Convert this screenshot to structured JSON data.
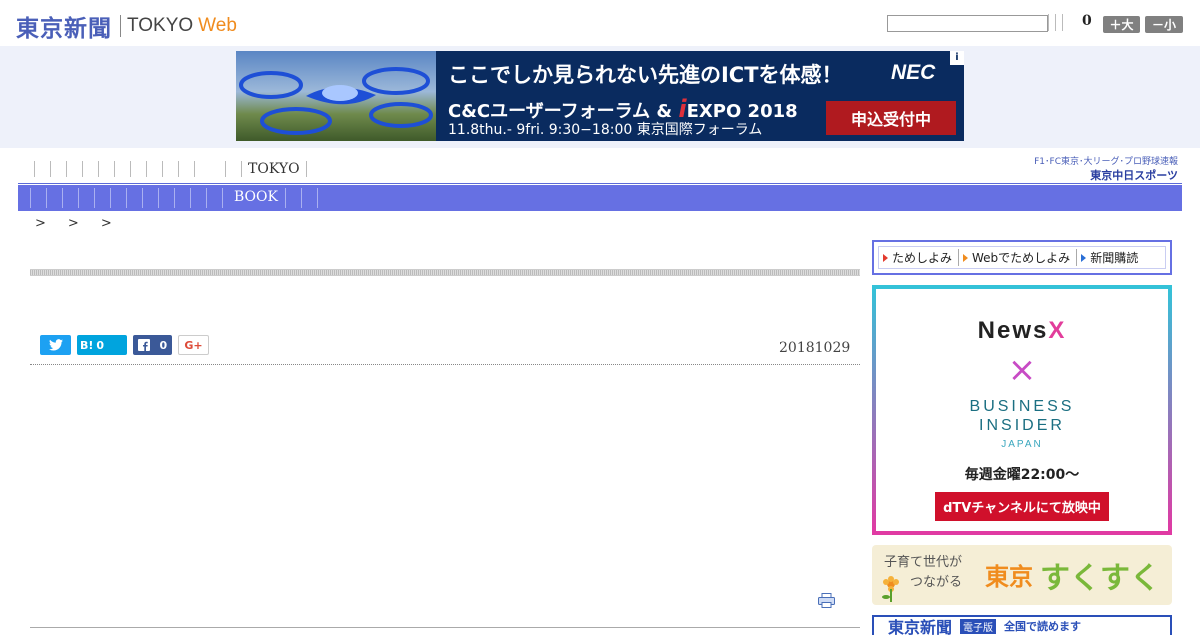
{
  "header": {
    "logo_jp": "東京新聞",
    "logo_en": "TOKYO",
    "logo_web": "Web",
    "count": "0",
    "font_bigger_label": "＋大",
    "font_smaller_label": "－小"
  },
  "ad_banner": {
    "headline": "ここでしか見られない先進のICTを体感！",
    "brand": "NEC",
    "info": "i",
    "event_prefix": "C&Cユーザーフォーラム &",
    "event_i": "i",
    "event_suffix": "EXPO 2018",
    "dates": "11.8thu.- 9fri. 9:30−18:00  東京国際フォーラム",
    "cta": "申込受付中"
  },
  "nav": {
    "tokyo_label": "TOKYO",
    "book_label": "BOOK",
    "chunichi_line1": "F1･FC東京･大リーグ･プロ野球速報",
    "chunichi_line2": "東京中日スポーツ"
  },
  "breadcrumb": [
    ">",
    ">",
    ">"
  ],
  "article": {
    "date": "20181029",
    "hatena_label": "B!",
    "hatena_count": "0",
    "facebook_count": "0",
    "gplus_label": "G+"
  },
  "sidebar": {
    "tabs": [
      "ためしよみ",
      "Webでためしよみ",
      "新聞購読"
    ],
    "ad": {
      "newsx_prefix": "News",
      "newsx_x": "X",
      "cross": "×",
      "bi_line1": "BUSINESS",
      "bi_line2": "INSIDER",
      "bi_line3": "JAPAN",
      "schedule": "毎週金曜22:00〜",
      "channel": "dTVチャンネルにて放映中"
    },
    "sukusuku": {
      "line1": "子育て世代が",
      "line2": "つながる",
      "brand1": "東京",
      "brand2": "すくすく"
    },
    "bottom": {
      "logo": "東京新聞",
      "badge": "電子版",
      "text": "全国で読めます"
    }
  },
  "colors": {
    "logo_blue": "#4a5fb8",
    "web_orange": "#f08c1e",
    "nav_band": "#6670e3",
    "twitter": "#1da1f2",
    "hatena": "#00a4de",
    "facebook": "#3b5998"
  }
}
